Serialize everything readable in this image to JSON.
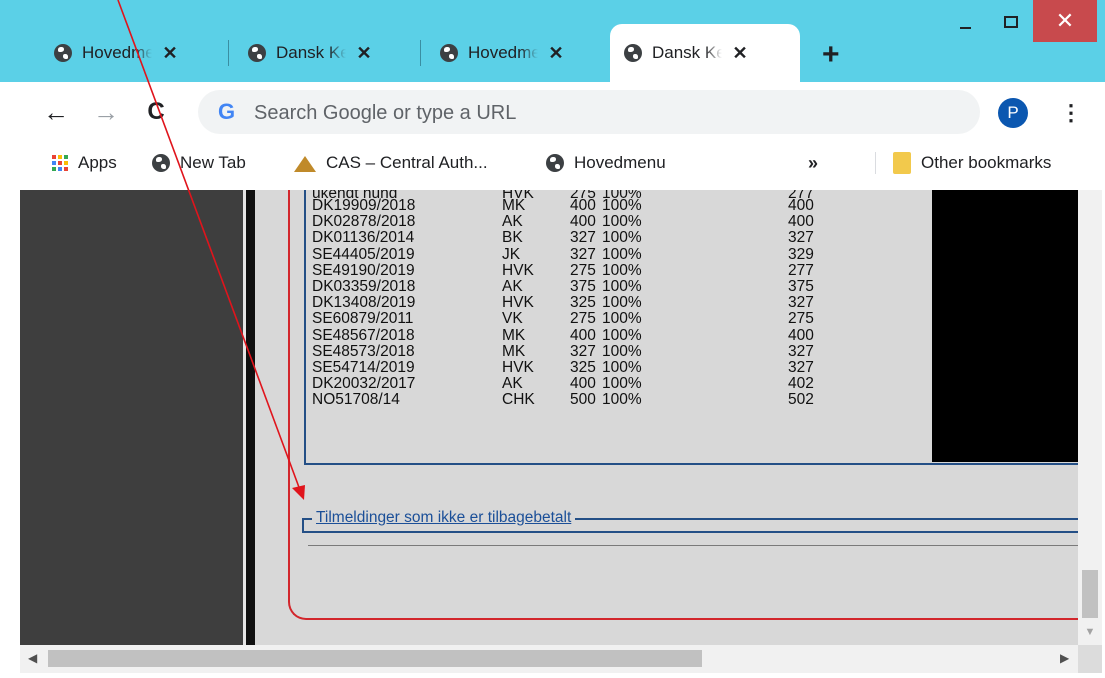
{
  "tabs": [
    {
      "title": "Hovedmenu"
    },
    {
      "title": "Dansk Kennel Klub"
    },
    {
      "title": "Hovedmenu"
    },
    {
      "title": "Dansk Kennel Klub"
    }
  ],
  "tab_close_glyph": "✕",
  "new_tab_glyph": "+",
  "window_controls": {
    "close_glyph": "✕"
  },
  "toolbar": {
    "back_glyph": "←",
    "forward_glyph": "→",
    "reload_glyph": "C",
    "google_logo": "G",
    "omnibox_placeholder": "Search Google or type a URL",
    "avatar_letter": "P",
    "menu_glyph": "⋮"
  },
  "bookmarks": {
    "apps": "Apps",
    "new_tab": "New Tab",
    "cas": "CAS – Central Auth...",
    "hovedmenu": "Hovedmenu",
    "overflow": "»",
    "other": "Other bookmarks"
  },
  "table": {
    "partial_row": {
      "id": "ukendt hund",
      "group": "HVK",
      "fee": "275",
      "pct": "100%",
      "total": "277"
    },
    "rows": [
      {
        "id": "DK19909/2018",
        "group": "MK",
        "fee": "400",
        "pct": "100%",
        "total": "400"
      },
      {
        "id": "DK02878/2018",
        "group": "AK",
        "fee": "400",
        "pct": "100%",
        "total": "400"
      },
      {
        "id": "DK01136/2014",
        "group": "BK",
        "fee": "327",
        "pct": "100%",
        "total": "327"
      },
      {
        "id": "SE44405/2019",
        "group": "JK",
        "fee": "327",
        "pct": "100%",
        "total": "329"
      },
      {
        "id": "SE49190/2019",
        "group": "HVK",
        "fee": "275",
        "pct": "100%",
        "total": "277"
      },
      {
        "id": "DK03359/2018",
        "group": "AK",
        "fee": "375",
        "pct": "100%",
        "total": "375"
      },
      {
        "id": "DK13408/2019",
        "group": "HVK",
        "fee": "325",
        "pct": "100%",
        "total": "327"
      },
      {
        "id": "SE60879/2011",
        "group": "VK",
        "fee": "275",
        "pct": "100%",
        "total": "275"
      },
      {
        "id": "SE48567/2018",
        "group": "MK",
        "fee": "400",
        "pct": "100%",
        "total": "400"
      },
      {
        "id": "SE48573/2018",
        "group": "MK",
        "fee": "327",
        "pct": "100%",
        "total": "327"
      },
      {
        "id": "SE54714/2019",
        "group": "HVK",
        "fee": "325",
        "pct": "100%",
        "total": "327"
      },
      {
        "id": "DK20032/2017",
        "group": "AK",
        "fee": "400",
        "pct": "100%",
        "total": "402"
      },
      {
        "id": "NO51708/14",
        "group": "CHK",
        "fee": "500",
        "pct": "100%",
        "total": "502"
      }
    ]
  },
  "section_link": "Tilmeldinger som ikke er tilbagebetalt",
  "colors": {
    "tabstrip": "#5bd0e7",
    "frame_red": "#d2262c",
    "fieldset_blue": "#244f86",
    "link_blue": "#1b4f98",
    "window_close": "#c84a4d"
  }
}
